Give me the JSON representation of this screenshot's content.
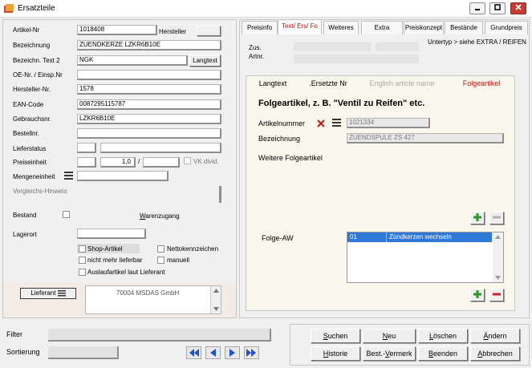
{
  "window": {
    "title": "Ersatzteile",
    "controls": [
      "minimize",
      "maximize",
      "close"
    ]
  },
  "left": {
    "fields": [
      {
        "label": "Artikel-Nr",
        "value": "1018408"
      },
      {
        "label": "Bezeichnung",
        "value": "ZUENDKERZE LZKR6B10E"
      },
      {
        "label": "Bezeichn. Text 2",
        "value": "NGK"
      },
      {
        "label": "OE-Nr. / Einsp.Nr",
        "value": ""
      },
      {
        "label": "Hersteller-Nr.",
        "value": "1578"
      },
      {
        "label": "EAN-Code",
        "value": "0087295115787"
      },
      {
        "label": "Gebrauchsnr.",
        "value": "LZKR6B10E"
      },
      {
        "label": "Bestellnr.",
        "value": ""
      },
      {
        "label": "Lieferstatus",
        "value": ""
      },
      {
        "label": "Preiseinheit",
        "value": "1,0"
      },
      {
        "label": "Mengeneinheit",
        "value": ""
      },
      {
        "label": "Vergleichs-Hinweis",
        "value": ""
      }
    ],
    "hersteller_button": "Hersteller",
    "langtext_button": "Langtext",
    "preis_slash": "/",
    "vk_divid": "VK divid.",
    "bestand_label": "Bestand",
    "warenzugang": "Warenzugang",
    "lagerort_label": "Lagerort",
    "checkboxes": {
      "shop_artikel": "Shop-Artikel",
      "nettokennzeichen": "Nettokennzeichen",
      "nicht_mehr_lieferbar": "nicht mehr lieferbar",
      "manuell": "manuell",
      "auslaufartikel": "Auslaufartikel laut Lieferant"
    },
    "lieferant_button": "Lieferant",
    "lieferant_value": "70004 MSDAS GmbH"
  },
  "right": {
    "tabs": [
      "Preisinfo",
      "Text/ Ers/ Fo",
      "Weiteres",
      "Extra",
      "Preiskonzept",
      "Bestände",
      "Grundpreis"
    ],
    "active_tab": "Text/ Ers/ Fo",
    "zus_label": "Zus.",
    "artnr_label": "Artnr.",
    "untertyp": "Untertyp > siehe EXTRA / REIFEN",
    "inner_tabs": [
      "Langtext",
      ".Ersetzte Nr",
      "English article name",
      "Folgeartikel"
    ],
    "active_inner_tab": "Folgeartikel",
    "heading": "Folgeartikel, z. B. \"Ventil zu Reifen\" etc.",
    "artikelnummer_label": "Artikelnummer",
    "artikelnummer_value": "1021334",
    "bezeichnung_label": "Bezeichnung",
    "bezeichnung_value": "ZUENDSPULE ZS 427",
    "weitere_label": "Weitere Folgeartikel",
    "folge_aw_label": "Folge-AW",
    "folge_aw_rows": [
      {
        "nr": "01",
        "text": "Zündkerzen wechseln"
      }
    ]
  },
  "bottom": {
    "filter_label": "Filter",
    "sortierung_label": "Sortierung",
    "buttons_row1": [
      {
        "label": "Suchen",
        "underline": "S"
      },
      {
        "label": "Neu",
        "underline": "N"
      },
      {
        "label": "Löschen",
        "underline": "L"
      },
      {
        "label": "Ändern",
        "underline": "Ä"
      }
    ],
    "buttons_row2": [
      {
        "label": "Historie",
        "underline": "H"
      },
      {
        "label": "Best.-Vermerk",
        "underline": "V"
      },
      {
        "label": "Beenden",
        "underline": "B"
      },
      {
        "label": "Abbrechen",
        "underline": "A"
      }
    ]
  },
  "colors": {
    "active_tab": "#b01010",
    "folge_selected": "#3078d8",
    "delete_x": "#b81818",
    "plus_green": "#2a9a2a",
    "minus_red": "#cc2233",
    "nav_blue": "#1a56c8"
  }
}
